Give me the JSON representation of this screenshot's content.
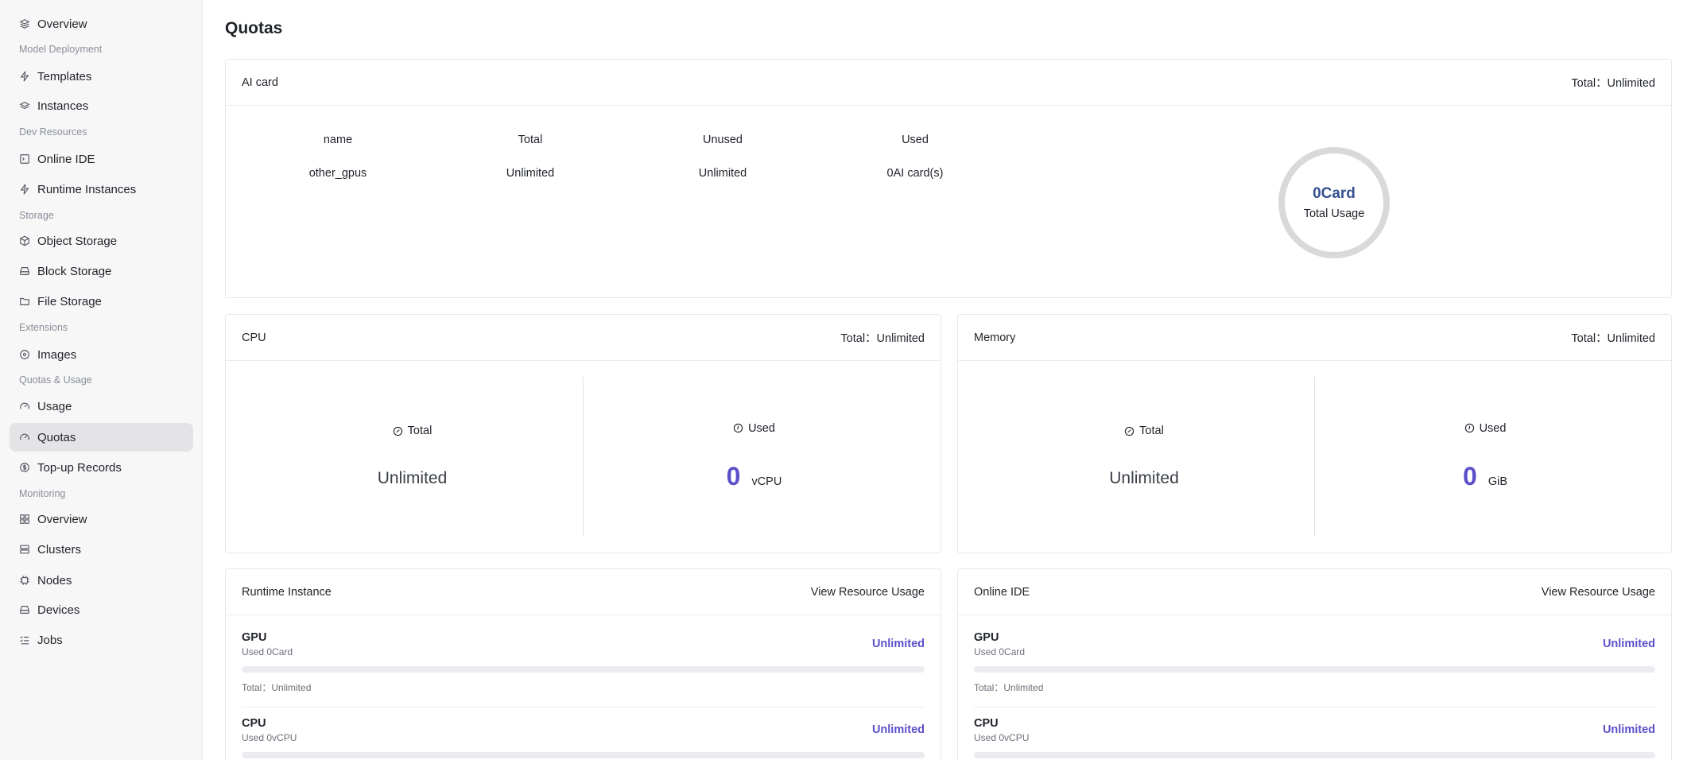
{
  "sidebar": {
    "items": [
      {
        "label": "Overview",
        "icon": "layers-icon"
      },
      {
        "section": "Model Deployment"
      },
      {
        "label": "Templates",
        "icon": "bolt-icon"
      },
      {
        "label": "Instances",
        "icon": "stack-icon"
      },
      {
        "section": "Dev Resources"
      },
      {
        "label": "Online IDE",
        "icon": "code-window-icon"
      },
      {
        "label": "Runtime Instances",
        "icon": "bolt-icon"
      },
      {
        "section": "Storage"
      },
      {
        "label": "Object Storage",
        "icon": "box-icon"
      },
      {
        "label": "Block Storage",
        "icon": "drive-icon"
      },
      {
        "label": "File Storage",
        "icon": "folder-icon"
      },
      {
        "section": "Extensions"
      },
      {
        "label": "Images",
        "icon": "disc-icon"
      },
      {
        "section": "Quotas & Usage"
      },
      {
        "label": "Usage",
        "icon": "gauge-icon"
      },
      {
        "label": "Quotas",
        "icon": "gauge-icon",
        "active": true
      },
      {
        "label": "Top-up Records",
        "icon": "coin-icon"
      },
      {
        "section": "Monitoring"
      },
      {
        "label": "Overview",
        "icon": "dashboard-icon"
      },
      {
        "label": "Clusters",
        "icon": "server-icon"
      },
      {
        "label": "Nodes",
        "icon": "chip-icon"
      },
      {
        "label": "Devices",
        "icon": "drive-icon"
      },
      {
        "label": "Jobs",
        "icon": "list-check-icon"
      }
    ]
  },
  "page": {
    "title": "Quotas"
  },
  "ai_card": {
    "title": "AI card",
    "total": "Total：Unlimited",
    "headers": [
      "name",
      "Total",
      "Unused",
      "Used"
    ],
    "rows": [
      [
        "other_gpus",
        "Unlimited",
        "Unlimited",
        "0AI card(s)"
      ]
    ],
    "donut_value": "0Card",
    "donut_label": "Total Usage"
  },
  "cpu": {
    "title": "CPU",
    "total": "Total：Unlimited",
    "total_label": "Total",
    "total_value": "Unlimited",
    "used_label": "Used",
    "used_value": "0",
    "used_unit": "vCPU"
  },
  "memory": {
    "title": "Memory",
    "total": "Total：Unlimited",
    "total_label": "Total",
    "total_value": "Unlimited",
    "used_label": "Used",
    "used_value": "0",
    "used_unit": "GiB"
  },
  "runtime_instance": {
    "title": "Runtime Instance",
    "link": "View Resource Usage",
    "items": [
      {
        "name": "GPU",
        "used": "Used 0Card",
        "value": "Unlimited",
        "total": "Total：Unlimited",
        "fill": 0
      },
      {
        "name": "CPU",
        "used": "Used 0vCPU",
        "value": "Unlimited",
        "fill": 0
      }
    ]
  },
  "online_ide": {
    "title": "Online IDE",
    "link": "View Resource Usage",
    "items": [
      {
        "name": "GPU",
        "used": "Used 0Card",
        "value": "Unlimited",
        "total": "Total：Unlimited",
        "fill": 0
      },
      {
        "name": "CPU",
        "used": "Used 0vCPU",
        "value": "Unlimited",
        "fill": 0
      }
    ]
  },
  "colors": {
    "accent": "#5b4fc9",
    "donut_text": "#35508f",
    "active_bg": "#e4e4e7"
  }
}
